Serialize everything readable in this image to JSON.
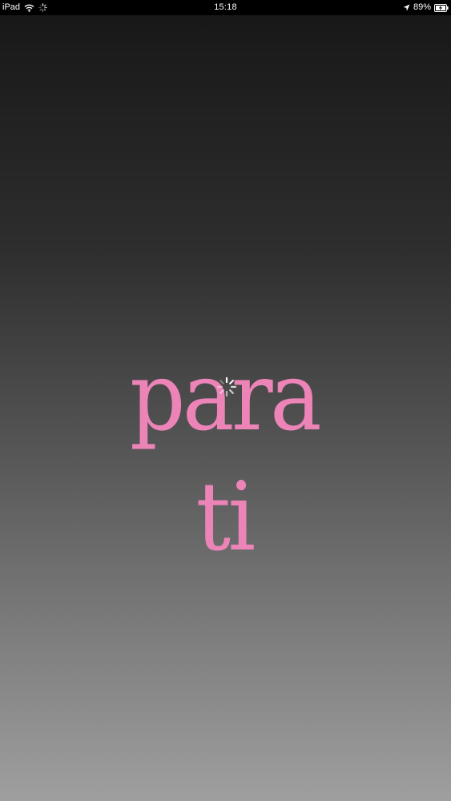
{
  "status_bar": {
    "device": "iPad",
    "time": "15:18",
    "battery": "89%"
  },
  "icons": {
    "wifi": "wifi-icon",
    "activity": "activity-spinner-icon",
    "location": "location-arrow-icon",
    "battery": "battery-charging-icon",
    "loading": "loading-spinner-icon"
  },
  "splash": {
    "logo": "para ti"
  },
  "colors": {
    "logo_pink": "#ec84b8",
    "gradient_top": "#181818",
    "gradient_bottom": "#9f9f9f",
    "status_bar_bg": "#000000"
  }
}
